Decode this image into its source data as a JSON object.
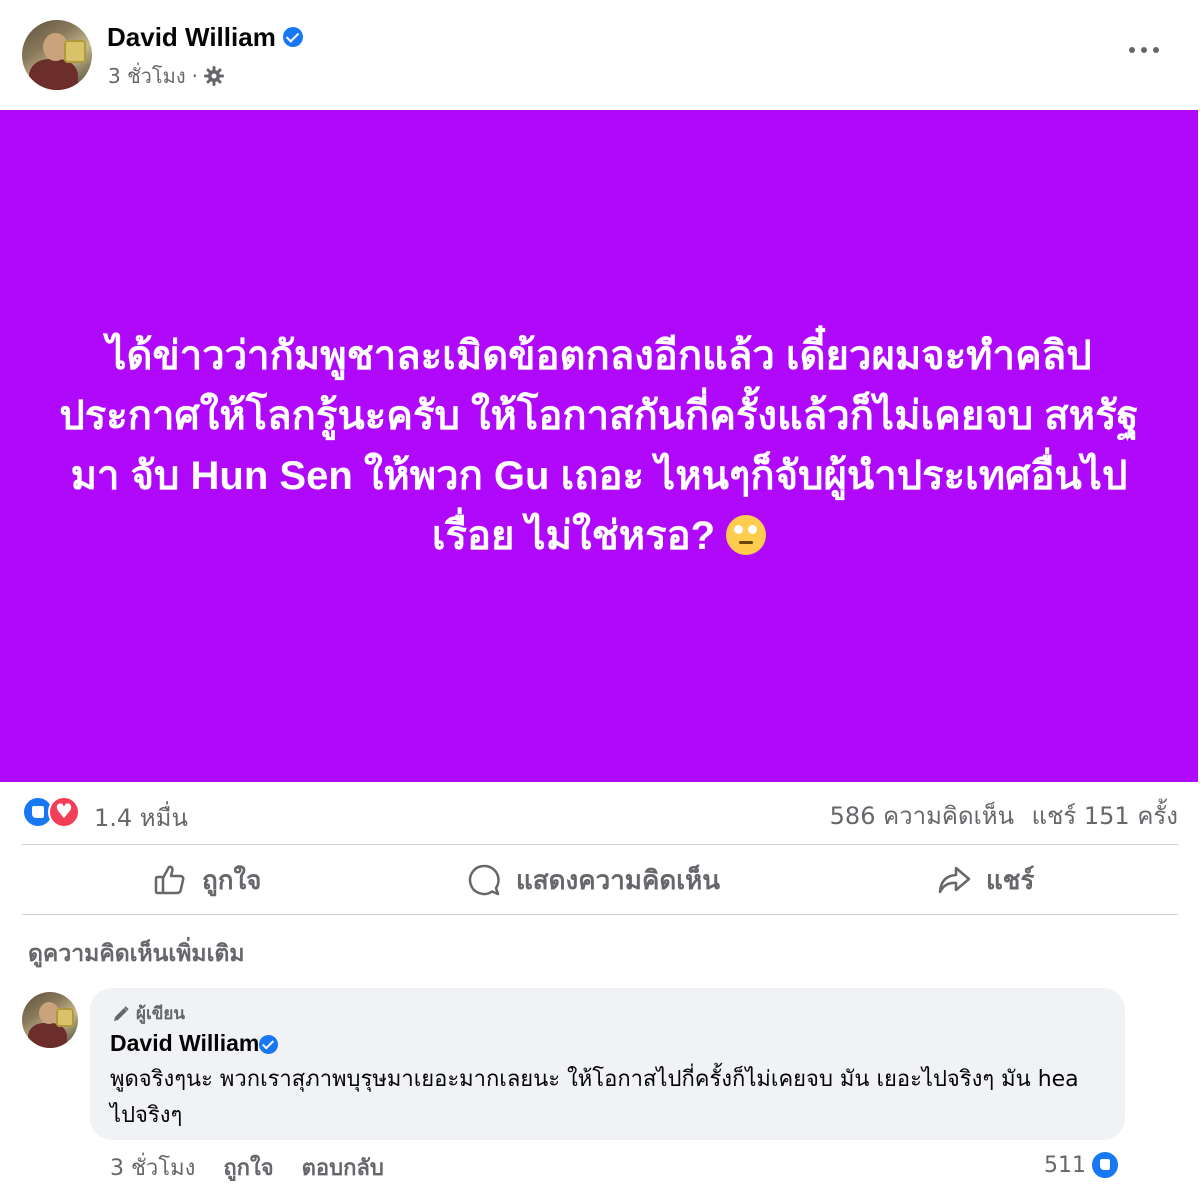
{
  "post": {
    "author": "David William",
    "time": "3 ชั่วโมง",
    "separator": "·",
    "text": "ได้ข่าวว่ากัมพูชาละเมิดข้อตกลงอีกแล้ว เดี๋ยวผมจะทำคลิปประกาศให้โลกรู้นะครับ ให้โอกาสกันกี่ครั้งแล้วก็ไม่เคยจบ สหรัฐมา จับ Hun Sen ให้พวก Gu เถอะ ไหนๆก็จับผู้นำประเทศอื่นไปเรื่อย ไม่ใช่หรอ?",
    "background_color": "#b008fb",
    "emoji": "face-with-rolling-eyes"
  },
  "stats": {
    "reactions": "1.4 หมื่น",
    "comments": "586 ความคิดเห็น",
    "shares": "แชร์ 151 ครั้ง"
  },
  "actions": {
    "like": "ถูกใจ",
    "comment": "แสดงความคิดเห็น",
    "share": "แชร์"
  },
  "view_more_comments": "ดูความคิดเห็นเพิ่มเติม",
  "comment": {
    "badge": "ผู้เขียน",
    "author": "David William",
    "text": "พูดจริงๆนะ พวกเราสุภาพบุรุษมาเยอะมากเลยนะ ให้โอกาสไปกี่ครั้งก็ไม่เคยจบ มัน เยอะไปจริงๆ มัน hea ไปจริงๆ",
    "time": "3 ชั่วโมง",
    "like_label": "ถูกใจ",
    "reply_label": "ตอบกลับ",
    "like_count": "511"
  }
}
